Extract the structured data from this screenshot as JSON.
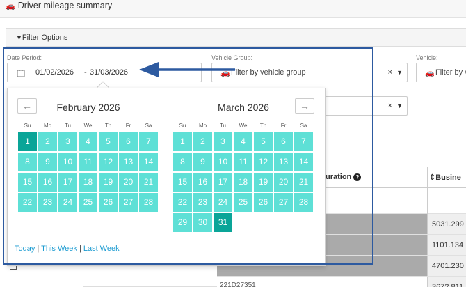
{
  "header": {
    "title": "Driver mileage summary"
  },
  "filters": {
    "panel_title": "Filter Options",
    "date_period_label": "Date Period:",
    "date_from": "01/02/2026",
    "date_sep": "-",
    "date_to": "31/03/2026",
    "vehicle_group_label": "Vehicle Group:",
    "vehicle_group_placeholder": "Filter by vehicle group",
    "vehicle_label": "Vehicle:",
    "vehicle_placeholder": "Filter by v"
  },
  "calendar": {
    "left_month": "February 2026",
    "right_month": "March 2026",
    "weekdays": [
      "Su",
      "Mo",
      "Tu",
      "We",
      "Th",
      "Fr",
      "Sa"
    ],
    "shortcuts": {
      "today": "Today",
      "this_week": "This Week",
      "last_week": "Last Week",
      "separator": "|"
    }
  },
  "table": {
    "col_duration": "uration",
    "col_business": "Busine",
    "values": [
      "5031.299",
      "1101.134",
      "4701.230",
      "3672.811"
    ],
    "bottom_cell_text": "221D27351"
  },
  "colors": {
    "day_fill": "#5ee0d6",
    "day_selected": "#0aa598",
    "annotation": "#2d5aa0"
  }
}
